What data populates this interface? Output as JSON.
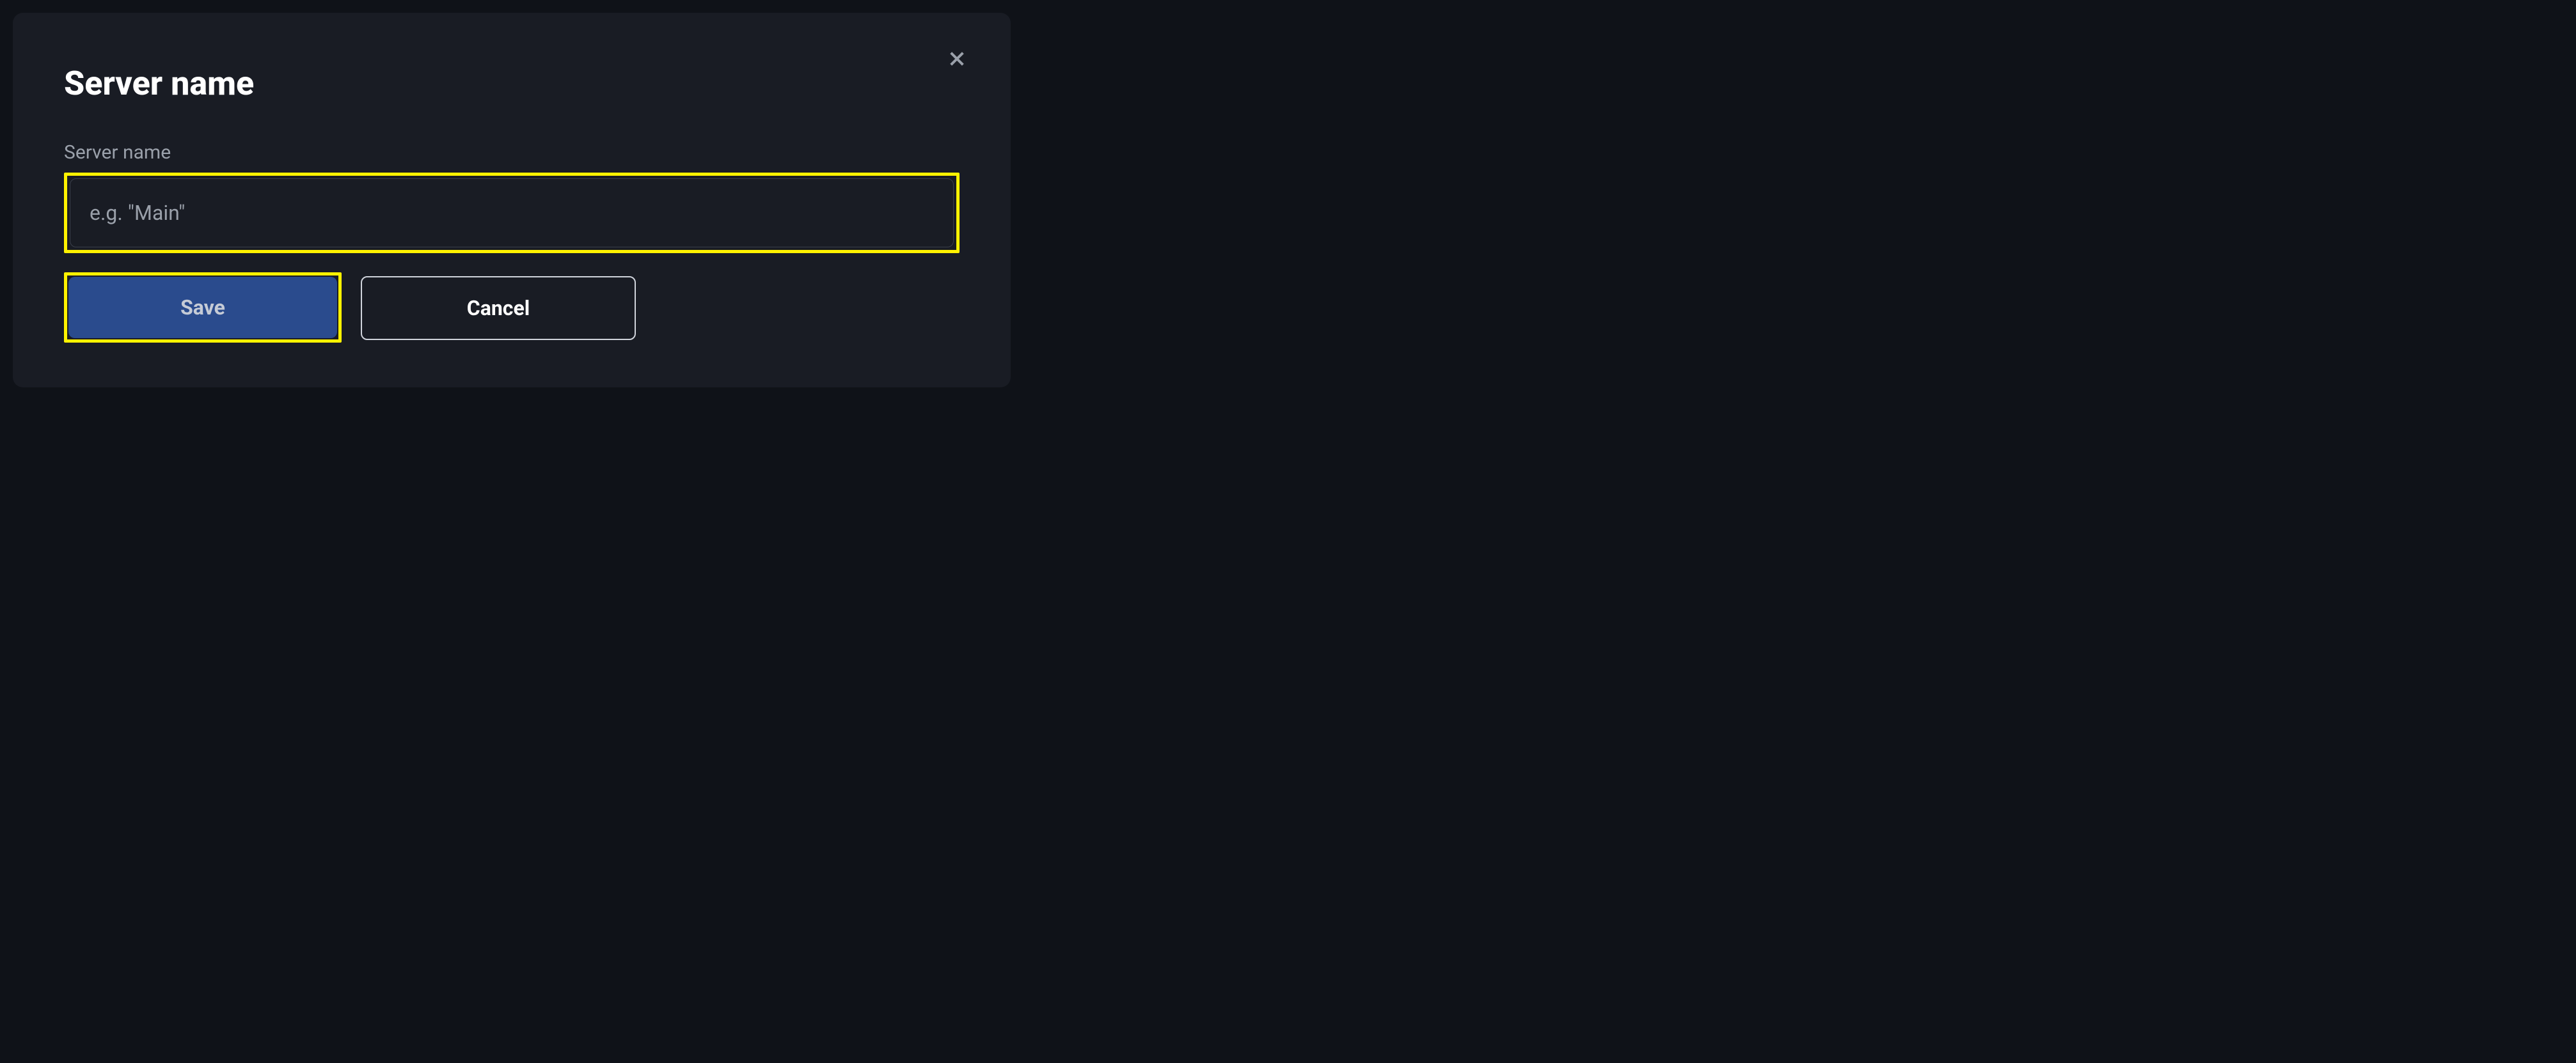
{
  "dialog": {
    "title": "Server name",
    "field_label": "Server name",
    "input_placeholder": "e.g. \"Main\"",
    "input_value": "",
    "save_label": "Save",
    "cancel_label": "Cancel"
  }
}
